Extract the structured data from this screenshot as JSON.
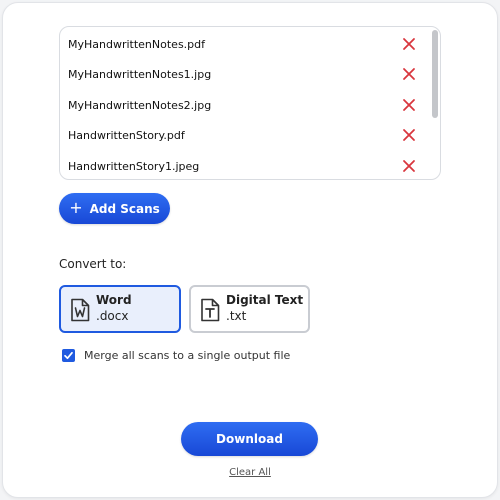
{
  "files": [
    {
      "name": "MyHandwrittenNotes.pdf"
    },
    {
      "name": "MyHandwrittenNotes1.jpg"
    },
    {
      "name": "MyHandwrittenNotes2.jpg"
    },
    {
      "name": "HandwrittenStory.pdf"
    },
    {
      "name": "HandwrittenStory1.jpeg"
    }
  ],
  "add_scans": {
    "label": "Add Scans",
    "icon": "plus-icon"
  },
  "convert": {
    "label": "Convert to:",
    "options": [
      {
        "title": "Word",
        "ext": ".docx",
        "icon": "word-document-icon",
        "selected": true
      },
      {
        "title": "Digital Text",
        "ext": ".txt",
        "icon": "text-document-icon",
        "selected": false
      }
    ]
  },
  "merge": {
    "label": "Merge all scans to a single output file",
    "checked": true
  },
  "download_label": "Download",
  "clear_label": "Clear All",
  "colors": {
    "accent": "#1f5ae0",
    "remove": "#d9363e",
    "selected_bg": "#e9effc"
  }
}
